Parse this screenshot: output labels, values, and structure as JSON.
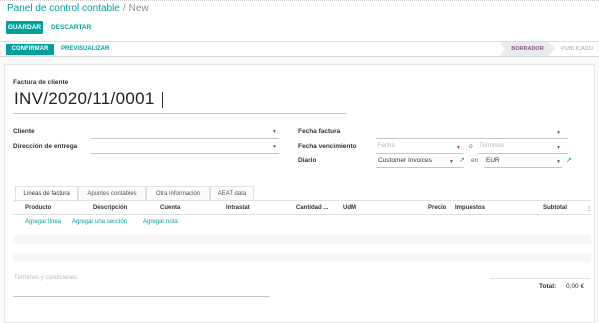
{
  "breadcrumb": {
    "parent": "Panel de control contable",
    "separator": "/",
    "current": "New"
  },
  "actions": {
    "save": "GUARDAR",
    "discard": "DESCARTAR"
  },
  "statusbar": {
    "confirm": "CONFIRMAR",
    "preview": "PREVISUALIZAR",
    "stages": [
      "BORRADOR",
      "PUBLICADO"
    ]
  },
  "form": {
    "doc_type": "Factura de cliente",
    "doc_name": "INV/2020/11/0001",
    "left_fields": {
      "customer_label": "Cliente",
      "delivery_label": "Dirección de entrega"
    },
    "right_fields": {
      "invoice_date_label": "Fecha factura",
      "due_date_label": "Fecha vencimiento",
      "due_date_placeholder": "Fecha",
      "or_text": "o",
      "terms_placeholder": "Términos",
      "journal_label": "Diario",
      "journal_value": "Customer Invoices",
      "in_text": "en",
      "currency_value": "EUR"
    }
  },
  "tabs": [
    "Líneas de factura",
    "Apuntes contables",
    "Otra información",
    "AEAT data"
  ],
  "table": {
    "headers": [
      "Producto",
      "Descripción",
      "Cuenta",
      "Intrastat",
      "Cantidad ...",
      "UdM",
      "Precio",
      "Impuestos",
      "Subtotal"
    ],
    "add_links": [
      "Agregar línea",
      "Agregar una sección",
      "Agregar nota"
    ]
  },
  "footer": {
    "terms_placeholder": "Términos y condiciones",
    "total_label": "Total:",
    "total_value": "0,00 €"
  },
  "icons": {
    "dropdown": "caret-down-icon",
    "external": "external-link-icon",
    "column_options": "column-options-icon"
  },
  "colors": {
    "accent": "#00a09d",
    "stage_active": "#875a7b"
  }
}
